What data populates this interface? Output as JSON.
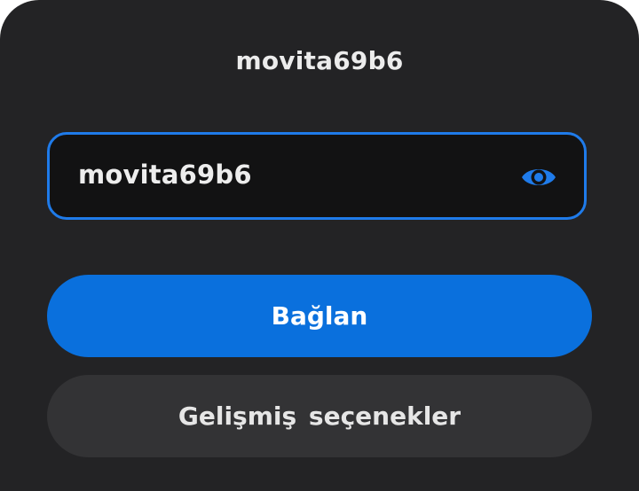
{
  "dialog": {
    "title": "movita69b6"
  },
  "password_field": {
    "value": "movita69b6",
    "toggle_icon": "eye-icon"
  },
  "buttons": {
    "connect_label": "Bağlan",
    "advanced_label": "Gelişmiş seçenekler"
  },
  "colors": {
    "accent": "#0a70dd",
    "focus_border": "#1f7bea",
    "background": "#232325",
    "field_background": "#121213",
    "secondary_button": "#333335"
  }
}
